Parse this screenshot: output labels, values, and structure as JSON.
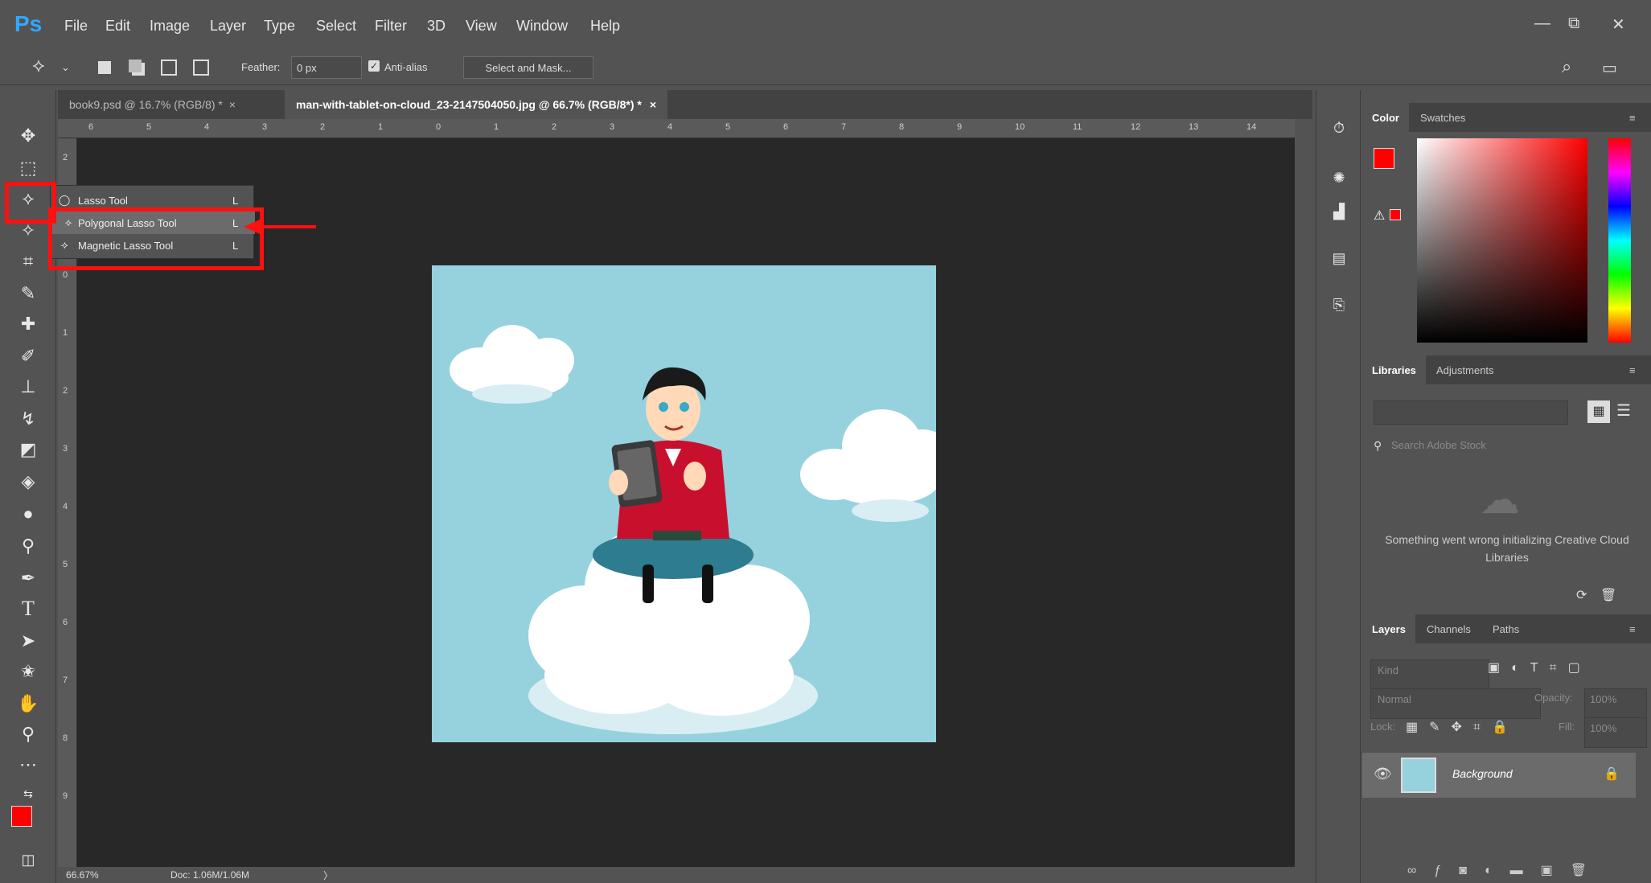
{
  "app": {
    "logo": "Ps"
  },
  "menu": {
    "items": [
      "File",
      "Edit",
      "Image",
      "Layer",
      "Type",
      "Select",
      "Filter",
      "3D",
      "View",
      "Window",
      "Help"
    ]
  },
  "window_controls": {
    "minimize": "—",
    "restore": "⧉",
    "close": "✕"
  },
  "options": {
    "feather_label": "Feather:",
    "feather_value": "0 px",
    "antialias_label": "Anti-alias",
    "select_mask_label": "Select and Mask..."
  },
  "tabs": [
    {
      "label": "book9.psd @ 16.7% (RGB/8) *",
      "close": "×"
    },
    {
      "label": "man-with-tablet-on-cloud_23-2147504050.jpg @ 66.7% (RGB/8*) *",
      "close": "×"
    }
  ],
  "ruler": {
    "top": [
      "6",
      "5",
      "4",
      "3",
      "2",
      "1",
      "0",
      "1",
      "2",
      "3",
      "4",
      "5",
      "6",
      "7",
      "8",
      "9",
      "10",
      "11",
      "12",
      "13",
      "14"
    ],
    "left": [
      "2",
      "1",
      "0",
      "1",
      "2",
      "3",
      "4",
      "5",
      "6",
      "7",
      "8",
      "9"
    ]
  },
  "flyout": {
    "items": [
      {
        "label": "Lasso Tool",
        "shortcut": "L"
      },
      {
        "label": "Polygonal Lasso Tool",
        "shortcut": "L"
      },
      {
        "label": "Magnetic Lasso Tool",
        "shortcut": "L"
      }
    ]
  },
  "status": {
    "zoom": "66.67%",
    "doc": "Doc: 1.06M/1.06M",
    "arrow": "〉"
  },
  "color_panel": {
    "tabs": [
      "Color",
      "Swatches"
    ],
    "foreground": "#ff0000",
    "background": "#ffffff"
  },
  "libraries_panel": {
    "tabs": [
      "Libraries",
      "Adjustments"
    ],
    "search_placeholder": "Search Adobe Stock",
    "error_text": "Something went wrong initializing Creative Cloud Libraries"
  },
  "layers_panel": {
    "tabs": [
      "Layers",
      "Channels",
      "Paths"
    ],
    "kind_placeholder": "Kind",
    "blend_mode": "Normal",
    "opacity_label": "Opacity:",
    "opacity_value": "100%",
    "lock_label": "Lock:",
    "fill_label": "Fill:",
    "fill_value": "100%",
    "layer_name": "Background"
  },
  "colors": {
    "accent_red": "#ff1010",
    "ps_blue": "#31a8ff",
    "canvas_bg": "#282828",
    "image_bg": "#96d1de"
  }
}
